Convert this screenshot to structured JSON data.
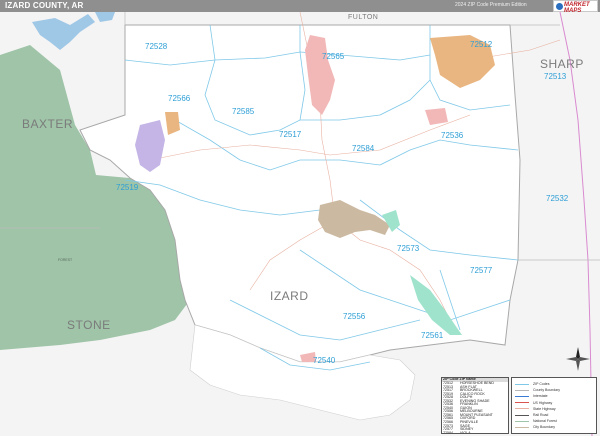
{
  "header": {
    "title": "IZARD COUNTY, AR",
    "edition": "2024 ZIP Code Premium Edition",
    "logo_text": "MARKET MAPS"
  },
  "counties": {
    "izard": "IZARD",
    "baxter": "BAXTER",
    "stone": "STONE",
    "sharp": "SHARP",
    "fulton": "FULTON"
  },
  "zip_codes": {
    "z72528": "72528",
    "z72565": "72565",
    "z72512": "72512",
    "z72513": "72513",
    "z72566": "72566",
    "z72585": "72585",
    "z72517": "72517",
    "z72536": "72536",
    "z72584": "72584",
    "z72519": "72519",
    "z72532": "72532",
    "z72573": "72573",
    "z72577": "72577",
    "z72556": "72556",
    "z72561": "72561",
    "z72540": "72540"
  },
  "places": {
    "forest": "FOREST"
  },
  "legend_table": {
    "header": "ZIP Code   ZIP Name",
    "rows": [
      {
        "zip": "72512",
        "name": "HORSESHOE BEND"
      },
      {
        "zip": "72513",
        "name": "ASH FLAT"
      },
      {
        "zip": "72517",
        "name": "BROCKWELL"
      },
      {
        "zip": "72519",
        "name": "CALICO ROCK"
      },
      {
        "zip": "72528",
        "name": "DOLPH"
      },
      {
        "zip": "72532",
        "name": "EVENING SHADE"
      },
      {
        "zip": "72536",
        "name": "FRANKLIN"
      },
      {
        "zip": "72540",
        "name": "GUION"
      },
      {
        "zip": "72556",
        "name": "MELBOURNE"
      },
      {
        "zip": "72561",
        "name": "MOUNT PLEASANT"
      },
      {
        "zip": "72565",
        "name": "OXFORD"
      },
      {
        "zip": "72566",
        "name": "PINEVILLE"
      },
      {
        "zip": "72573",
        "name": "SAGE"
      },
      {
        "zip": "72577",
        "name": "SIDNEY"
      },
      {
        "zip": "72584",
        "name": "VIOLA"
      },
      {
        "zip": "72585",
        "name": "WIDEMAN"
      }
    ]
  },
  "legend_key": {
    "items": [
      "ZIP Codes",
      "County Boundary",
      "Interstate",
      "US Highway",
      "State Highway",
      "Rail Road",
      "National Forest",
      "City Boundary"
    ]
  },
  "colors": {
    "zip_label": "#2e9fd6",
    "zip_boundary": "#7fc8e8",
    "county_boundary": "#b7b7b7",
    "forest_green": "#9fc4a8",
    "water": "#9fc7e6",
    "city_tan": "#cbb9a1",
    "city_purple": "#c4b5e6",
    "city_pink": "#f2b7b7",
    "city_orange": "#e9b580",
    "city_teal": "#9fe3cd",
    "state_border": "#d98ad0",
    "road": "#e8b0a0"
  }
}
